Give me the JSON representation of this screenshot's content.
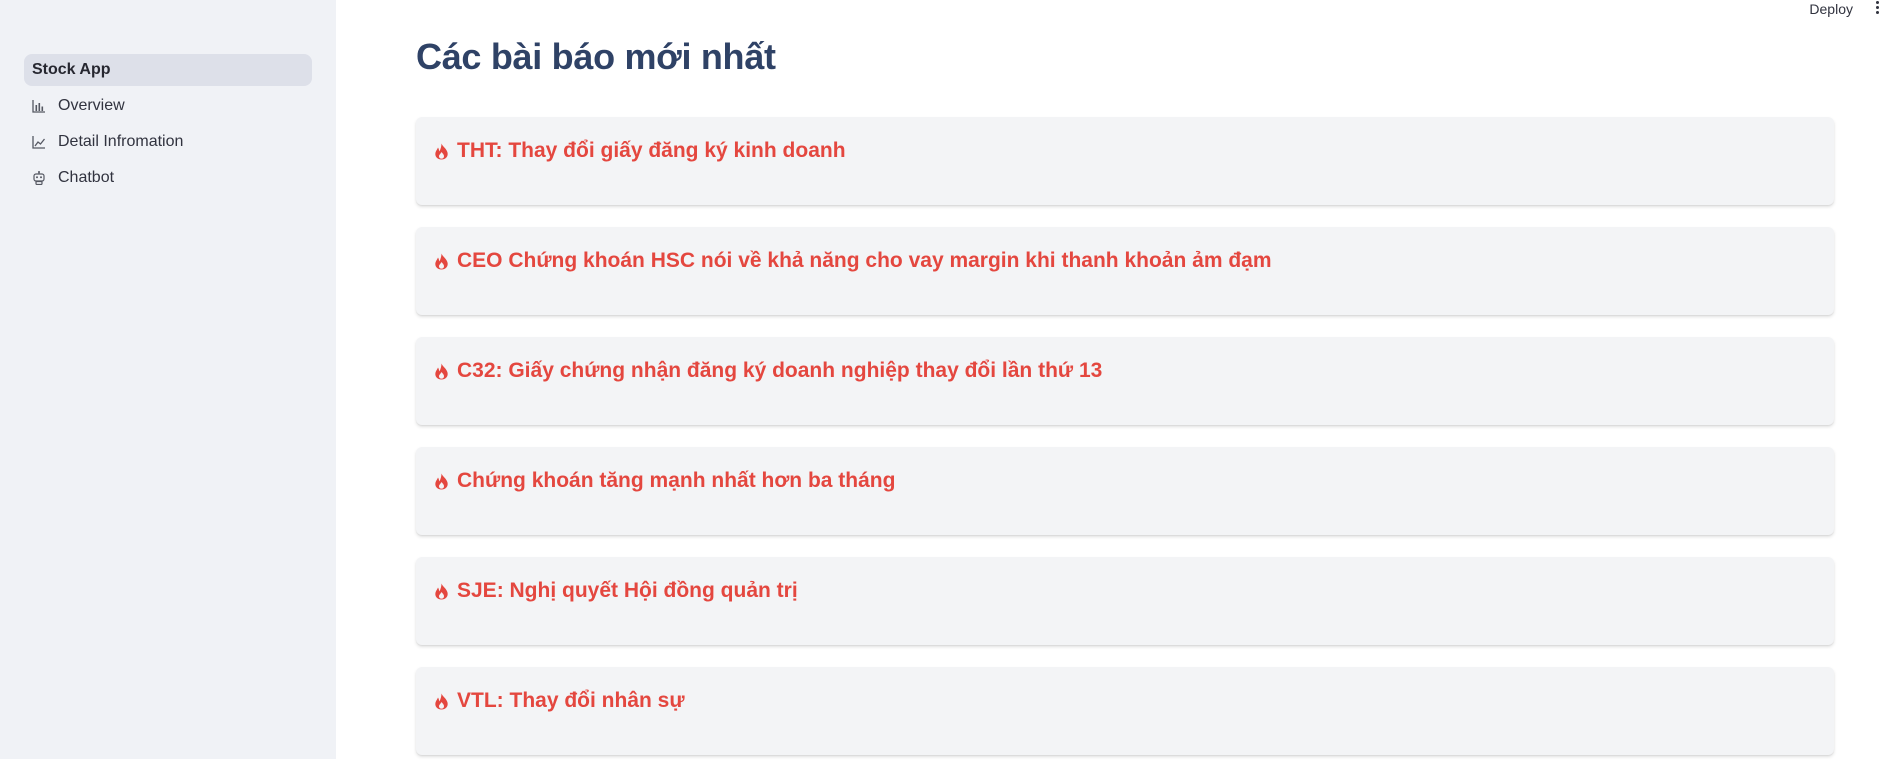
{
  "sidebar": {
    "items": [
      {
        "label": "Stock App",
        "icon": "none",
        "active": true
      },
      {
        "label": "Overview",
        "icon": "bar-chart-icon",
        "active": false
      },
      {
        "label": "Detail Infromation",
        "icon": "line-chart-icon",
        "active": false
      },
      {
        "label": "Chatbot",
        "icon": "robot-icon",
        "active": false
      }
    ]
  },
  "header": {
    "deploy_label": "Deploy",
    "menu_icon": "kebab-menu-icon"
  },
  "main": {
    "title": "Các bài báo mới nhất",
    "articles": [
      {
        "title": "THT: Thay đổi giấy đăng ký kinh doanh",
        "icon": "fire-icon"
      },
      {
        "title": "CEO Chứng khoán HSC nói về khả năng cho vay margin khi thanh khoản ảm đạm",
        "icon": "fire-icon"
      },
      {
        "title": "C32: Giấy chứng nhận đăng ký doanh nghiệp thay đổi lần thứ 13",
        "icon": "fire-icon"
      },
      {
        "title": "Chứng khoán tăng mạnh nhất hơn ba tháng",
        "icon": "fire-icon"
      },
      {
        "title": "SJE: Nghị quyết Hội đồng quản trị",
        "icon": "fire-icon"
      },
      {
        "title": "VTL: Thay đổi nhân sự",
        "icon": "fire-icon"
      }
    ]
  },
  "colors": {
    "sidebar_bg": "#f0f2f6",
    "active_item_bg": "#dde0e9",
    "title_color": "#2f4266",
    "article_color": "#e4473f",
    "card_bg": "#f3f4f6"
  }
}
